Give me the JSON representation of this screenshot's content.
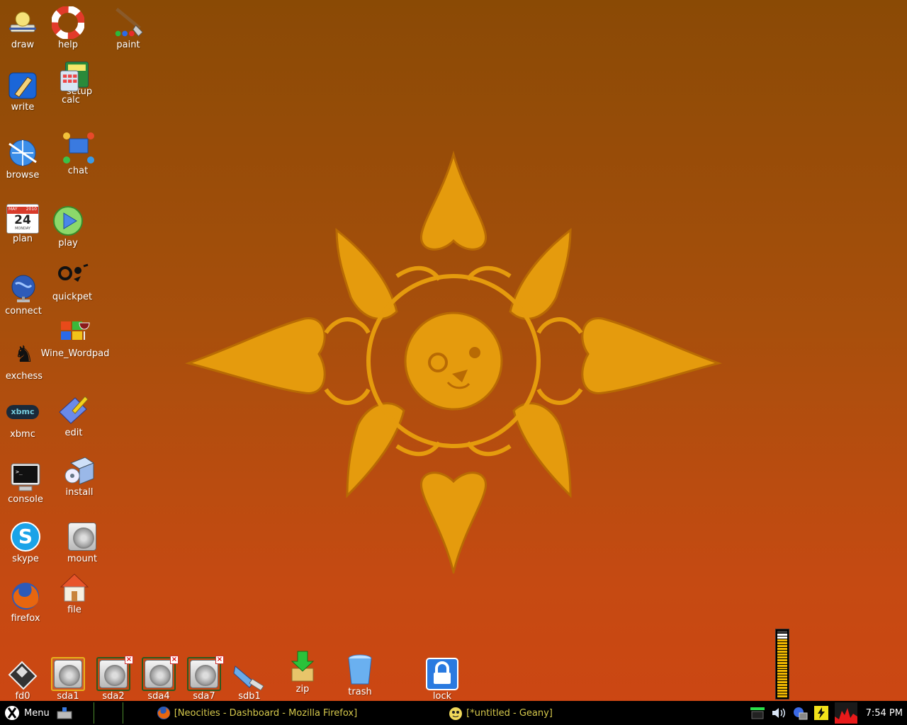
{
  "desktop": {
    "icons": {
      "draw": "draw",
      "help": "help",
      "paint": "paint",
      "write": "write",
      "setup": "setup",
      "calc": "calc",
      "browse": "browse",
      "chat": "chat",
      "plan": "plan",
      "plan_month": "MAY",
      "plan_year": "2010",
      "plan_day": "24",
      "plan_weekday": "MONDAY",
      "play": "play",
      "quickpet": "quickpet",
      "connect": "connect",
      "exchess": "exchess",
      "wine_wordpad": "Wine_Wordpad",
      "xbmc": "xbmc",
      "xbmc_logo": "xbmc",
      "edit": "edit",
      "console": "console",
      "install": "install",
      "skype": "skype",
      "mount": "mount",
      "firefox": "firefox",
      "file": "file"
    },
    "drives": [
      {
        "label": "fd0"
      },
      {
        "label": "sda1"
      },
      {
        "label": "sda2"
      },
      {
        "label": "sda4"
      },
      {
        "label": "sda7"
      },
      {
        "label": "sdb1"
      }
    ],
    "bottom_icons": {
      "zip": "zip",
      "trash": "trash",
      "lock": "lock"
    },
    "volume_level": 0.96
  },
  "taskbar": {
    "menu_label": "Menu",
    "tasks": [
      {
        "title": "[Neocities - Dashboard - Mozilla Firefox]"
      },
      {
        "title": "[*untitled - Geany]"
      }
    ],
    "clock": "7:54 PM"
  },
  "colors": {
    "bg_top": "#8a4a05",
    "bg_bottom": "#cd4613",
    "emblem": "#e8a10c",
    "taskbar_bg": "#000000",
    "task_text": "#d6c94c"
  }
}
